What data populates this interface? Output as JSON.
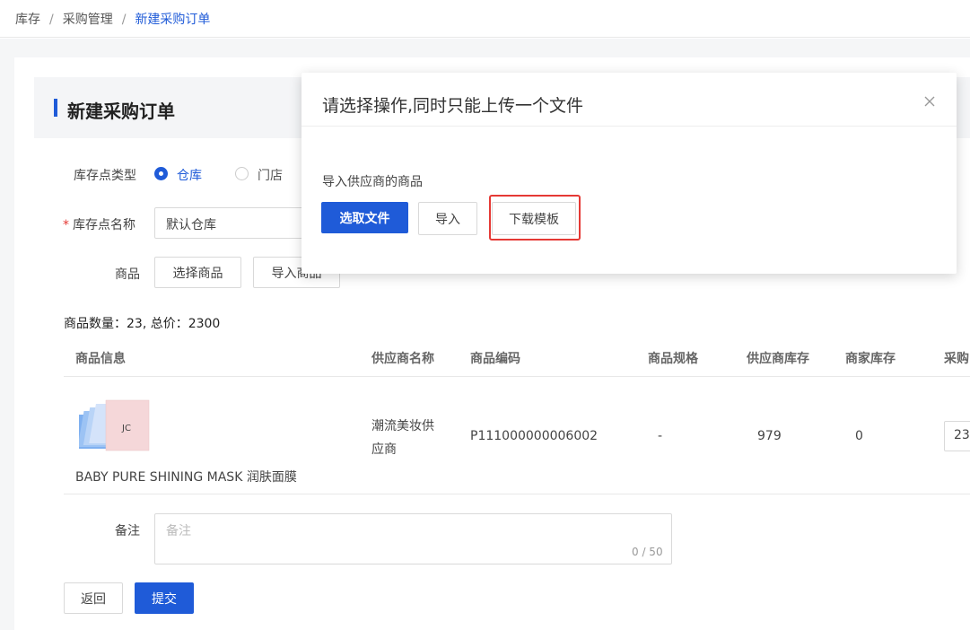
{
  "breadcrumb": {
    "items": [
      "库存",
      "采购管理"
    ],
    "current": "新建采购订单"
  },
  "page_title": "新建采购订单",
  "form": {
    "store_type_label": "库存点类型",
    "store_type_options": [
      "仓库",
      "门店"
    ],
    "store_type_selected": "仓库",
    "store_name_label": "库存点名称",
    "store_name_value": "默认仓库",
    "goods_label": "商品",
    "select_goods_button": "选择商品",
    "import_goods_button": "导入商品"
  },
  "summary": "商品数量：23, 总价：2300",
  "table": {
    "headers": [
      "商品信息",
      "供应商名称",
      "商品编码",
      "商品规格",
      "供应商库存",
      "商家库存",
      "采购"
    ],
    "rows": [
      {
        "name": "BABY PURE SHINING MASK 润肤面膜",
        "supplier_line1": "潮流美妆供",
        "supplier_line2": "应商",
        "code": "P111000000006002",
        "spec": "-",
        "supplier_stock": "979",
        "merchant_stock": "0",
        "qty": "23"
      }
    ]
  },
  "remark": {
    "label": "备注",
    "placeholder": "备注",
    "counter": "0 / 50"
  },
  "footer": {
    "back_button": "返回",
    "submit_button": "提交"
  },
  "modal": {
    "title": "请选择操作,同时只能上传一个文件",
    "subtitle": "导入供应商的商品",
    "choose_file_button": "选取文件",
    "import_button": "导入",
    "download_template_button": "下载模板",
    "close_icon": "close-icon"
  },
  "colors": {
    "primary": "#1f5bd8",
    "highlight": "#e53935"
  }
}
